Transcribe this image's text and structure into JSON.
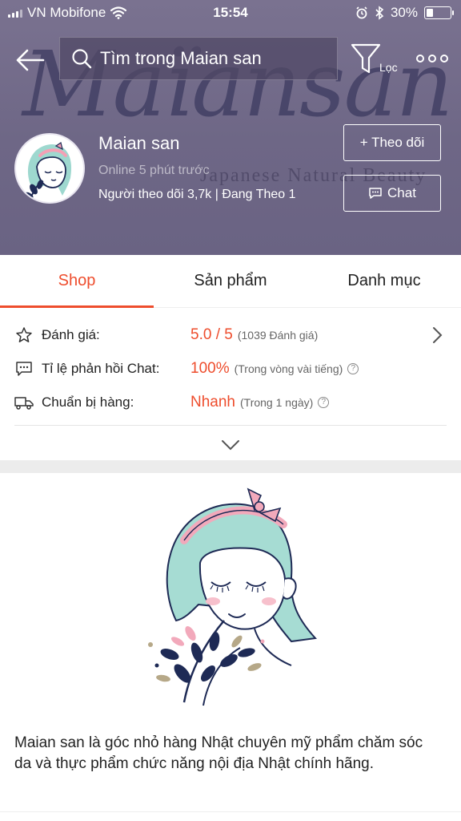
{
  "status_bar": {
    "carrier": "VN Mobifone",
    "time": "15:54",
    "battery": "30%",
    "battery_level": 0.3
  },
  "header": {
    "search_placeholder": "Tìm trong Maian san",
    "filter_label": "Lọc",
    "brand_watermark": "Maïansan",
    "brand_tagline": "Japanese Natural Beauty",
    "shop_name": "Maian san",
    "online_status": "Online 5 phút trước",
    "follow_stats": "Người theo dõi 3,7k | Đang Theo 1",
    "follow_button": "+ Theo dõi",
    "chat_button": "Chat"
  },
  "tabs": [
    {
      "label": "Shop",
      "active": true
    },
    {
      "label": "Sản phẩm",
      "active": false
    },
    {
      "label": "Danh mục",
      "active": false
    }
  ],
  "stats": {
    "rating": {
      "label": "Đánh giá:",
      "value": "5.0 / 5",
      "note": "(1039 Đánh giá)"
    },
    "chat_response": {
      "label": "Tỉ lệ phản hồi Chat:",
      "value": "100%",
      "note": "(Trong vòng vài tiếng)"
    },
    "preparation": {
      "label": "Chuẩn bị hàng:",
      "value": "Nhanh",
      "note": "(Trong 1 ngày)"
    }
  },
  "description": "Maian san là góc nhỏ hàng Nhật chuyên mỹ phẩm chăm sóc da và thực phẩm chức năng nội địa Nhật chính hãng.",
  "colors": {
    "accent": "#ee4d2d",
    "header_bg": "#716a89"
  }
}
